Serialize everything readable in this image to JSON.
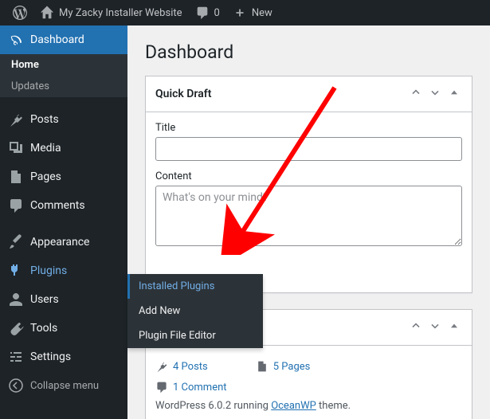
{
  "topbar": {
    "site_name": "My Zacky Installer Website",
    "comment_count": "0",
    "new_label": "New"
  },
  "sidebar": {
    "dashboard": "Dashboard",
    "home": "Home",
    "updates": "Updates",
    "posts": "Posts",
    "media": "Media",
    "pages": "Pages",
    "comments": "Comments",
    "appearance": "Appearance",
    "plugins": "Plugins",
    "users": "Users",
    "tools": "Tools",
    "settings": "Settings",
    "collapse": "Collapse menu"
  },
  "flyout": {
    "installed": "Installed Plugins",
    "add_new": "Add New",
    "editor": "Plugin File Editor"
  },
  "page": {
    "heading": "Dashboard"
  },
  "quickdraft": {
    "title": "Quick Draft",
    "label_title": "Title",
    "label_content": "Content",
    "placeholder_content": "What's on your mind?"
  },
  "glance": {
    "posts": "4 Posts",
    "pages": "5 Pages",
    "comments": "1 Comment",
    "footer_prefix": "WordPress 6.0.2 running ",
    "footer_theme": "OceanWP",
    "footer_suffix": " theme."
  }
}
